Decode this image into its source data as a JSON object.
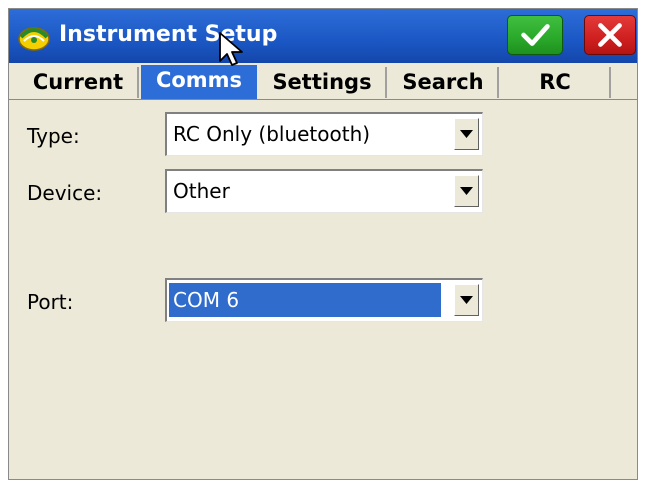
{
  "window": {
    "title": "Instrument Setup",
    "titlebar_color": "#1b57c4",
    "ok_icon": "checkmark-icon",
    "close_icon": "close-x-icon"
  },
  "tabs": [
    {
      "label": "Current",
      "active": false
    },
    {
      "label": "Comms",
      "active": true
    },
    {
      "label": "Settings",
      "active": false
    },
    {
      "label": "Search",
      "active": false
    },
    {
      "label": "RC",
      "active": false
    }
  ],
  "form": {
    "type": {
      "label": "Type:",
      "value": "RC Only (bluetooth)"
    },
    "device": {
      "label": "Device:",
      "value": "Other"
    },
    "port": {
      "label": "Port:",
      "value": "COM 6"
    }
  },
  "colors": {
    "accent": "#2d6dd8",
    "selection": "#2f6ccb",
    "ok_green": "#2aa82a",
    "close_red": "#cf1f1f",
    "panel": "#ece9d8"
  }
}
